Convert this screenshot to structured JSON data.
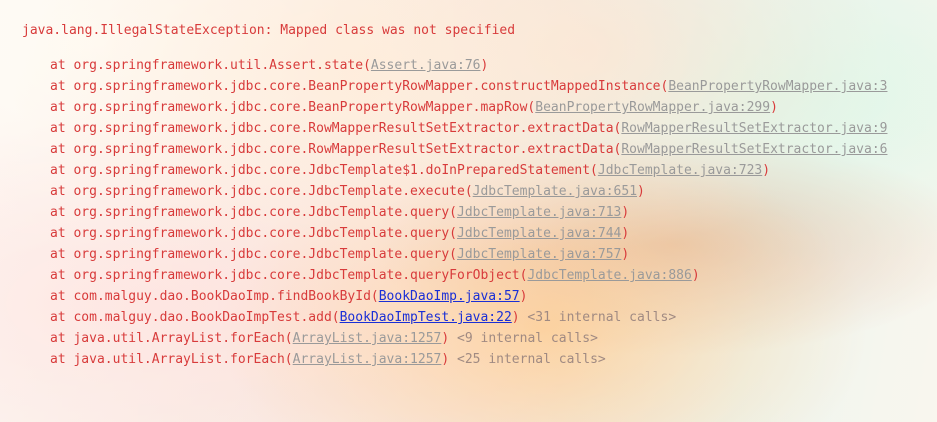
{
  "console": {
    "exception": "java.lang.IllegalStateException: Mapped class was not specified",
    "frames": [
      {
        "prefix": "at ",
        "method": "org.springframework.util.Assert.state(",
        "link": "Assert.java:76",
        "link_type": "internal",
        "suffix": ")",
        "note": ""
      },
      {
        "prefix": "at ",
        "method": "org.springframework.jdbc.core.BeanPropertyRowMapper.constructMappedInstance(",
        "link": "BeanPropertyRowMapper.java:3",
        "link_type": "internal",
        "suffix": "",
        "note": ""
      },
      {
        "prefix": "at ",
        "method": "org.springframework.jdbc.core.BeanPropertyRowMapper.mapRow(",
        "link": "BeanPropertyRowMapper.java:299",
        "link_type": "internal",
        "suffix": ")",
        "note": ""
      },
      {
        "prefix": "at ",
        "method": "org.springframework.jdbc.core.RowMapperResultSetExtractor.extractData(",
        "link": "RowMapperResultSetExtractor.java:9",
        "link_type": "internal",
        "suffix": "",
        "note": ""
      },
      {
        "prefix": "at ",
        "method": "org.springframework.jdbc.core.RowMapperResultSetExtractor.extractData(",
        "link": "RowMapperResultSetExtractor.java:6",
        "link_type": "internal",
        "suffix": "",
        "note": ""
      },
      {
        "prefix": "at ",
        "method": "org.springframework.jdbc.core.JdbcTemplate$1.doInPreparedStatement(",
        "link": "JdbcTemplate.java:723",
        "link_type": "internal",
        "suffix": ")",
        "note": ""
      },
      {
        "prefix": "at ",
        "method": "org.springframework.jdbc.core.JdbcTemplate.execute(",
        "link": "JdbcTemplate.java:651",
        "link_type": "internal",
        "suffix": ")",
        "note": ""
      },
      {
        "prefix": "at ",
        "method": "org.springframework.jdbc.core.JdbcTemplate.query(",
        "link": "JdbcTemplate.java:713",
        "link_type": "internal",
        "suffix": ")",
        "note": ""
      },
      {
        "prefix": "at ",
        "method": "org.springframework.jdbc.core.JdbcTemplate.query(",
        "link": "JdbcTemplate.java:744",
        "link_type": "internal",
        "suffix": ")",
        "note": ""
      },
      {
        "prefix": "at ",
        "method": "org.springframework.jdbc.core.JdbcTemplate.query(",
        "link": "JdbcTemplate.java:757",
        "link_type": "internal",
        "suffix": ")",
        "note": ""
      },
      {
        "prefix": "at ",
        "method": "org.springframework.jdbc.core.JdbcTemplate.queryForObject(",
        "link": "JdbcTemplate.java:886",
        "link_type": "internal",
        "suffix": ")",
        "note": ""
      },
      {
        "prefix": "at ",
        "method": "com.malguy.dao.BookDaoImp.findBookById(",
        "link": "BookDaoImp.java:57",
        "link_type": "user",
        "suffix": ")",
        "note": ""
      },
      {
        "prefix": "at ",
        "method": "com.malguy.dao.BookDaoImpTest.add(",
        "link": "BookDaoImpTest.java:22",
        "link_type": "user",
        "suffix": ")",
        "note": " <31 internal calls>"
      },
      {
        "prefix": "at ",
        "method": "java.util.ArrayList.forEach(",
        "link": "ArrayList.java:1257",
        "link_type": "internal",
        "suffix": ")",
        "note": " <9 internal calls>"
      },
      {
        "prefix": "at ",
        "method": "java.util.ArrayList.forEach(",
        "link": "ArrayList.java:1257",
        "link_type": "internal",
        "suffix": ")",
        "note": " <25 internal calls>"
      }
    ]
  },
  "colors": {
    "error_text": "#d83b3b",
    "internal_link": "#9a9a9a",
    "user_link": "#1a2fd6",
    "internal_calls_note": "#a08a82"
  }
}
